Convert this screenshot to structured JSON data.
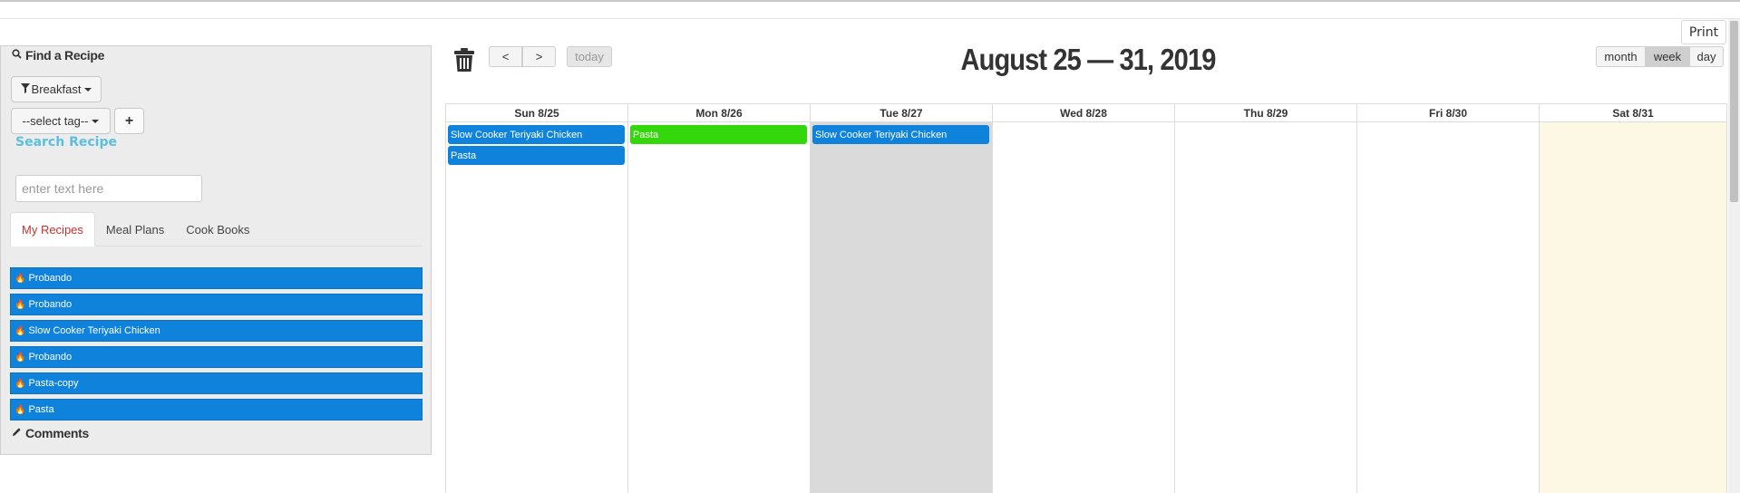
{
  "header": {
    "print_label": "Print"
  },
  "sidebar": {
    "find_title": "Find a Recipe",
    "category_dropdown": "Breakfast",
    "tag_dropdown": "--select tag--",
    "add_tag_label": "+",
    "search_label": "Search Recipe",
    "search_placeholder": "enter text here",
    "tabs": [
      "My Recipes",
      "Meal Plans",
      "Cook Books"
    ],
    "active_tab": "My Recipes",
    "recipes": [
      "Probando",
      "Probando",
      "Slow Cooker Teriyaki Chicken",
      "Probando",
      "Pasta-copy",
      "Pasta"
    ],
    "comments_title": "Comments"
  },
  "calendar": {
    "today_label": "today",
    "prev_label": "<",
    "next_label": ">",
    "title": "August 25 — 31, 2019",
    "views": [
      "month",
      "week",
      "day"
    ],
    "active_view": "week",
    "days": [
      {
        "label": "Sun 8/25",
        "events": [
          {
            "title": "Slow Cooker Teriyaki Chicken",
            "color": "#0f83db"
          },
          {
            "title": "Pasta",
            "color": "#0f83db"
          }
        ]
      },
      {
        "label": "Mon 8/26",
        "events": [
          {
            "title": "Pasta",
            "color": "#34d70a"
          }
        ]
      },
      {
        "label": "Tue 8/27",
        "events": [
          {
            "title": "Slow Cooker Teriyaki Chicken",
            "color": "#0f83db"
          }
        ]
      },
      {
        "label": "Wed 8/28",
        "events": []
      },
      {
        "label": "Thu 8/29",
        "events": []
      },
      {
        "label": "Fri 8/30",
        "events": []
      },
      {
        "label": "Sat 8/31",
        "events": []
      }
    ],
    "colors": {
      "tuesday_background": "#dadada",
      "today_background": "#fcf8e3",
      "event_blue": "#0f83db",
      "event_green": "#34d70a"
    }
  }
}
